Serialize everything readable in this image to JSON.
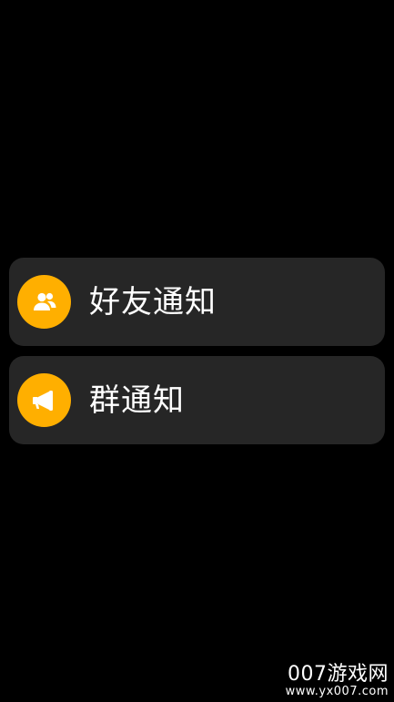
{
  "notifications": {
    "items": [
      {
        "label": "好友通知",
        "icon": "friends-icon"
      },
      {
        "label": "群通知",
        "icon": "megaphone-icon"
      }
    ]
  },
  "watermark": {
    "main": "007游戏网",
    "url": "www.yx007.com"
  },
  "colors": {
    "background": "#000000",
    "card": "#262626",
    "accent": "#FFAF00",
    "text": "#FFFFFF"
  }
}
